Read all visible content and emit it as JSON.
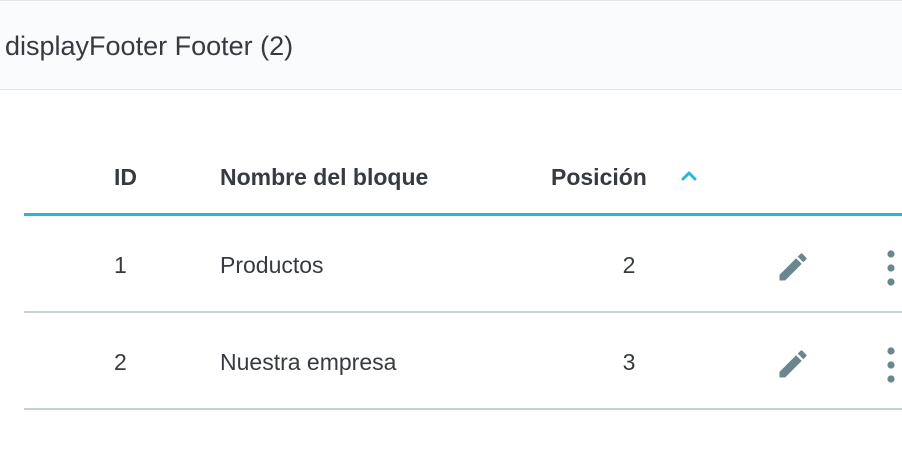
{
  "card": {
    "title": "displayFooter Footer (2)"
  },
  "table": {
    "columns": {
      "id": "ID",
      "name": "Nombre del bloque",
      "position": "Posición",
      "position_sort": "ascending"
    },
    "rows": [
      {
        "id": "1",
        "name": "Productos",
        "position": "2"
      },
      {
        "id": "2",
        "name": "Nuestra empresa",
        "position": "3"
      }
    ]
  },
  "icons": {
    "sort": "chevron-up-icon",
    "edit": "pencil-icon",
    "more": "more-vertical-icon"
  },
  "colors": {
    "accent": "#25b9d7",
    "text": "#363a41",
    "icon": "#6c868e",
    "border": "#c6d2d6",
    "header_bg": "#fafbfc"
  }
}
